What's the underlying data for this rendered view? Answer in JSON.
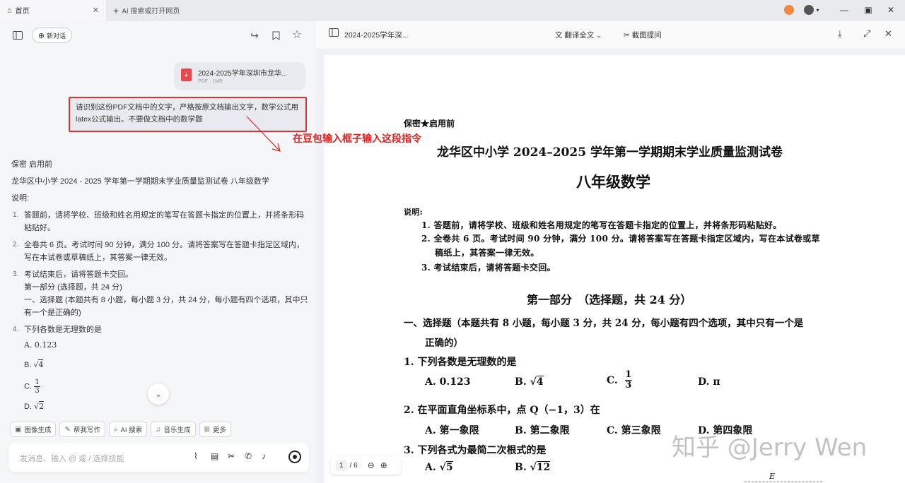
{
  "tabs": {
    "home": "首页",
    "new_tab": "AI 搜索或打开网页"
  },
  "left": {
    "new_chat": "新对话",
    "file": {
      "name": "2024-2025学年深圳市龙华...",
      "size": "PDF · 1MB"
    },
    "prompt": "请识别这份PDF文档中的文字，严格按原文档输出文字，数学公式用latex公式输出。不要做文档中的数学题",
    "annotation": "在豆包输入框子输入这段指令",
    "response": {
      "l1": "保密 启用前",
      "l2": "龙华区中小学 2024 - 2025 学年第一学期期末学业质量监测试卷 八年级数学",
      "l3": "说明:",
      "items": [
        {
          "num": "1.",
          "text": "答题前，请将学校、班级和姓名用规定的笔写在答题卡指定的位置上，并将条形码粘贴好。"
        },
        {
          "num": "2.",
          "text": "全卷共 6 页。考试时间 90 分钟，满分 100 分。请将答案写在答题卡指定区域内，写在本试卷或草稿纸上，其答案一律无效。"
        },
        {
          "num": "3.",
          "text": "考试结束后，请将答题卡交回。"
        }
      ],
      "part1": "第一部分 (选择题，共 24 分)",
      "sec1": "一、选择题 (本题共有 8 小题，每小题 3 分，共 24 分，每小题有四个选项，其中只有一个是正确的)",
      "q4_num": "4.",
      "q4": "下列各数是无理数的是",
      "optA": "A. 0.123",
      "optB_label": "B.",
      "optB_val": "4",
      "optC_label": "C.",
      "optC_num": "1",
      "optC_den": "3",
      "optD_label": "D.",
      "optD_val": "2"
    },
    "chips": [
      "图像生成",
      "帮我写作",
      "AI 搜索",
      "音乐生成",
      "更多"
    ],
    "input_placeholder": "发消息、输入 @ 或 / 选择技能"
  },
  "viewer": {
    "title": "2024-2025学年深...",
    "translate": "翻译全文",
    "screenshot_ask": "截图提问",
    "page_current": "1",
    "page_total": "/ 6"
  },
  "doc": {
    "secret": "保密★启用前",
    "title1": "龙华区中小学 2024–2025 学年第一学期期末学业质量监测试卷",
    "title2": "八年级数学",
    "note_label": "说明:",
    "note1": "1. 答题前，请将学校、班级和姓名用规定的笔写在答题卡指定的位置上，并将条形码粘贴好。",
    "note2a": "2. 全卷共 6 页。考试时间 90 分钟，满分 100 分。请将答案写在答题卡指定区域内，写在本试卷或草",
    "note2b": "稿纸上，其答案一律无效。",
    "note3": "3. 考试结束后，请将答题卡交回。",
    "part1": "第一部分　（选择题，共 24 分）",
    "sec1a": "一、选择题（本题共有 8 小题，每小题 3 分，共 24 分，每小题有四个选项，其中只有一个是",
    "sec1b": "正确的）",
    "q1": "1. 下列各数是无理数的是",
    "q1A": "A. 0.123",
    "q1B": "B.",
    "q1B_val": "4",
    "q1C": "C.",
    "q1C_num": "1",
    "q1C_den": "3",
    "q1D": "D. π",
    "q2": "2. 在平面直角坐标系中，点 Q（−1，3）在",
    "q2A": "A. 第一象限",
    "q2B": "B. 第二象限",
    "q2C": "C. 第三象限",
    "q2D": "D. 第四象限",
    "q3": "3. 下列各式为最简二次根式的是",
    "q3A": "A.",
    "q3A_val": "5",
    "q3B": "B.",
    "q3B_val": "12",
    "fig_label": "E"
  },
  "watermark": "知乎 @Jerry Wen"
}
